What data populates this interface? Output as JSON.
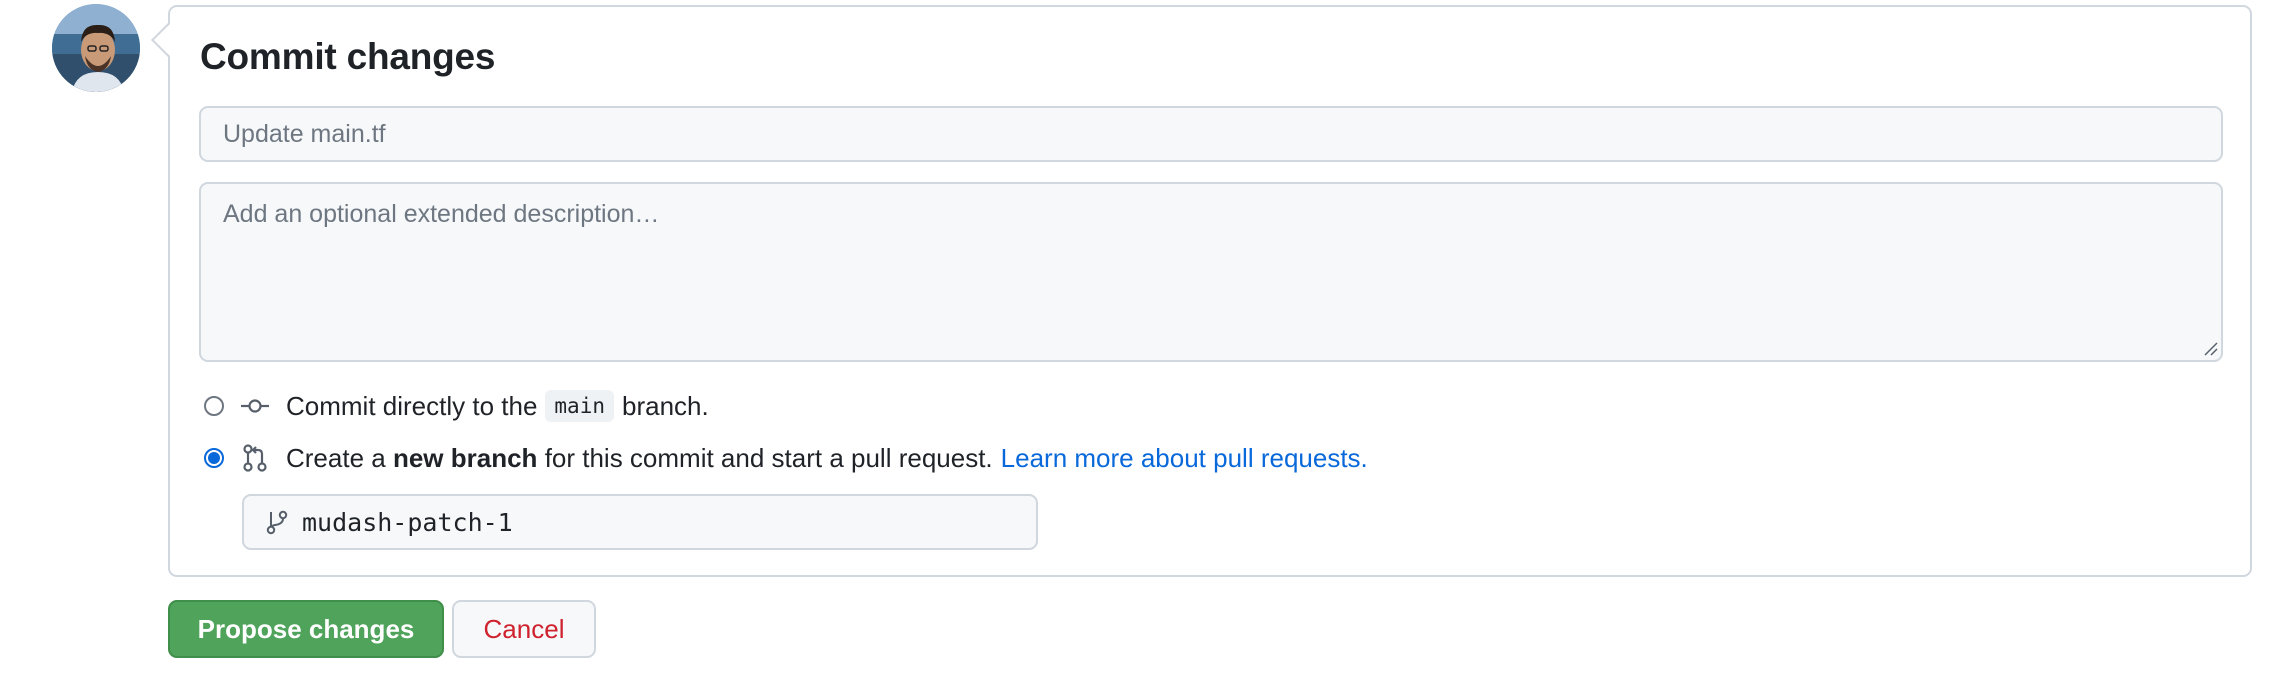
{
  "commit": {
    "title": "Commit changes",
    "summary_placeholder": "Update main.tf",
    "description_placeholder": "Add an optional extended description…"
  },
  "options": {
    "direct": {
      "prefix": "Commit directly to the",
      "branch": "main",
      "suffix": "branch.",
      "selected": false
    },
    "new_branch": {
      "prefix": "Create a",
      "bold": "new branch",
      "suffix": "for this commit and start a pull request.",
      "link": "Learn more about pull requests.",
      "selected": true,
      "branch_name": "mudash-patch-1"
    }
  },
  "actions": {
    "propose_label": "Propose changes",
    "cancel_label": "Cancel"
  },
  "icons": {
    "avatar": "user-avatar",
    "commit": "git-commit-icon",
    "pull_request": "git-pull-request-icon",
    "branch": "git-branch-icon"
  },
  "colors": {
    "accent": "#0969da",
    "primary_button": "#4fa35a",
    "danger_text": "#cf222e"
  }
}
